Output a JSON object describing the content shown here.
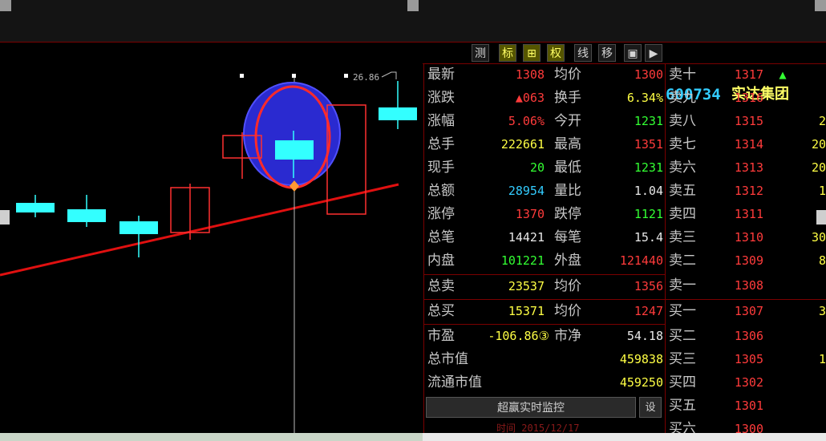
{
  "toolbar": {
    "buttons": [
      "测",
      "标",
      "⊞",
      "权",
      "线",
      "移",
      "▣",
      "▶"
    ],
    "stock_code": "600734",
    "stock_name": "实达集团"
  },
  "chart": {
    "price_label": "26.86"
  },
  "quote": {
    "rows": [
      {
        "l1": "最新",
        "v1": "1308",
        "c1": "red",
        "l2": "均价",
        "v2": "1300",
        "c2": "red"
      },
      {
        "l1": "涨跌",
        "v1": "▲063",
        "c1": "red",
        "l2": "换手",
        "v2": "6.34%",
        "c2": "yellow"
      },
      {
        "l1": "涨幅",
        "v1": "5.06%",
        "c1": "red",
        "l2": "今开",
        "v2": "1231",
        "c2": "green"
      },
      {
        "l1": "总手",
        "v1": "222661",
        "c1": "yellow",
        "l2": "最高",
        "v2": "1351",
        "c2": "red"
      },
      {
        "l1": "现手",
        "v1": "20",
        "c1": "green",
        "l2": "最低",
        "v2": "1231",
        "c2": "green"
      },
      {
        "l1": "总额",
        "v1": "28954",
        "c1": "cyan",
        "l2": "量比",
        "v2": "1.04",
        "c2": "white"
      },
      {
        "l1": "涨停",
        "v1": "1370",
        "c1": "red",
        "l2": "跌停",
        "v2": "1121",
        "c2": "green"
      },
      {
        "l1": "总笔",
        "v1": "14421",
        "c1": "white",
        "l2": "每笔",
        "v2": "15.4",
        "c2": "white"
      },
      {
        "l1": "内盘",
        "v1": "101221",
        "c1": "green",
        "l2": "外盘",
        "v2": "121440",
        "c2": "red"
      },
      {
        "l1": "总卖",
        "v1": "23537",
        "c1": "yellow",
        "l2": "均价",
        "v2": "1356",
        "c2": "red"
      },
      {
        "l1": "总买",
        "v1": "15371",
        "c1": "yellow",
        "l2": "均价",
        "v2": "1247",
        "c2": "red"
      },
      {
        "l1": "市盈",
        "v1": "-106.86③",
        "c1": "yellow",
        "l2": "市净",
        "v2": "54.18",
        "c2": "white"
      },
      {
        "l1": "总市值",
        "v1": "",
        "c1": "white",
        "l2": "",
        "v2": "459838",
        "c2": "yellow"
      },
      {
        "l1": "流通市值",
        "v1": "",
        "c1": "white",
        "l2": "",
        "v2": "459250",
        "c2": "yellow"
      }
    ],
    "monitor_button": "超赢实时监控",
    "monitor_settings": "设",
    "time_text": "时间 2015/12/17"
  },
  "orderbook": {
    "sell": [
      {
        "label": "卖十",
        "price": "1317",
        "vol": "▲"
      },
      {
        "label": "卖九",
        "price": "1316",
        "vol": ""
      },
      {
        "label": "卖八",
        "price": "1315",
        "vol": "2"
      },
      {
        "label": "卖七",
        "price": "1314",
        "vol": "20"
      },
      {
        "label": "卖六",
        "price": "1313",
        "vol": "20"
      },
      {
        "label": "卖五",
        "price": "1312",
        "vol": "1"
      },
      {
        "label": "卖四",
        "price": "1311",
        "vol": ""
      },
      {
        "label": "卖三",
        "price": "1310",
        "vol": "30"
      },
      {
        "label": "卖二",
        "price": "1309",
        "vol": "8"
      },
      {
        "label": "卖一",
        "price": "1308",
        "vol": ""
      }
    ],
    "buy": [
      {
        "label": "买一",
        "price": "1307",
        "vol": "3"
      },
      {
        "label": "买二",
        "price": "1306",
        "vol": ""
      },
      {
        "label": "买三",
        "price": "1305",
        "vol": "1"
      },
      {
        "label": "买四",
        "price": "1302",
        "vol": ""
      },
      {
        "label": "买五",
        "price": "1301",
        "vol": ""
      },
      {
        "label": "买六",
        "price": "1300",
        "vol": ""
      }
    ]
  }
}
